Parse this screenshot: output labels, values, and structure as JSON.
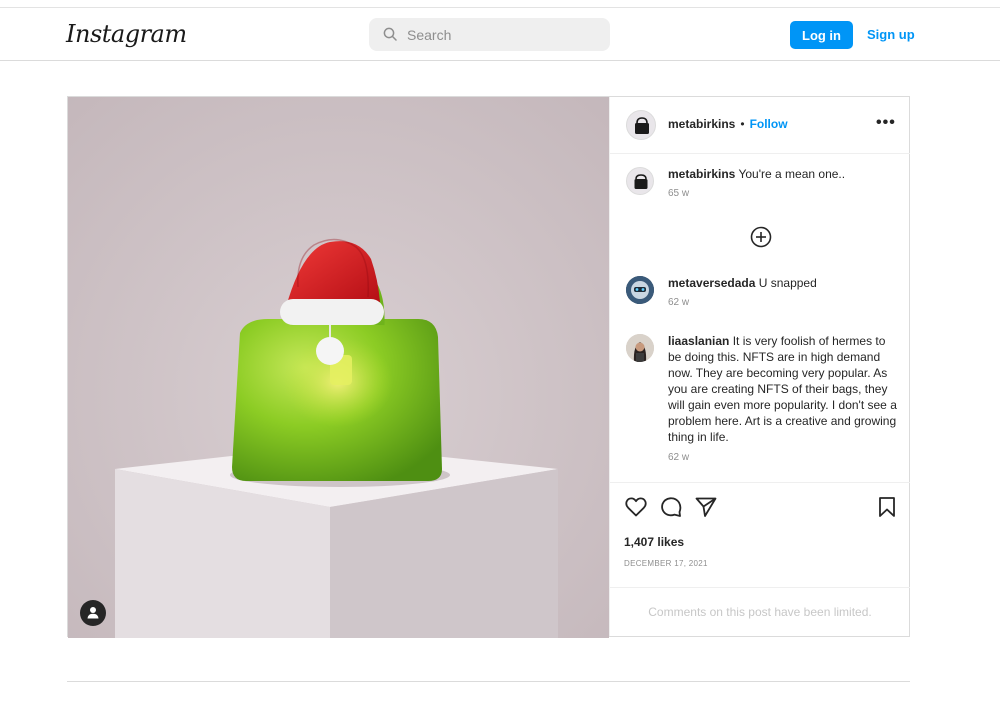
{
  "header": {
    "logo": "Instagram",
    "search_placeholder": "Search",
    "login_label": "Log in",
    "signup_label": "Sign up"
  },
  "post": {
    "author": "metabirkins",
    "follow_label": "Follow",
    "separator": "•",
    "more_label": "•••",
    "likes": "1,407 likes",
    "date": "December 17, 2021",
    "comments_limited": "Comments on this post have been limited."
  },
  "comments": [
    {
      "username": "metabirkins",
      "text": "You're a mean one..",
      "time": "65 w"
    },
    {
      "username": "metaversedada",
      "text": "U snapped",
      "time": "62 w"
    },
    {
      "username": "liaaslanian",
      "text": "It is very foolish of hermes to be doing this. NFTS are in high demand now. They are becoming very popular. As you are creating NFTS of their bags, they will gain even more popularity. I don't see a problem here. Art is a creative and growing thing in life.",
      "time": "62 w"
    }
  ],
  "icons": {
    "search": "search-icon",
    "load_more": "plus-circle-icon",
    "like": "heart-icon",
    "comment": "comment-icon",
    "share": "send-icon",
    "save": "bookmark-icon",
    "tags": "user-tag-icon"
  },
  "colors": {
    "accent": "#0095f6",
    "bag": "#7bc11c",
    "hat": "#d8141c",
    "background": "#cdc1c5"
  }
}
